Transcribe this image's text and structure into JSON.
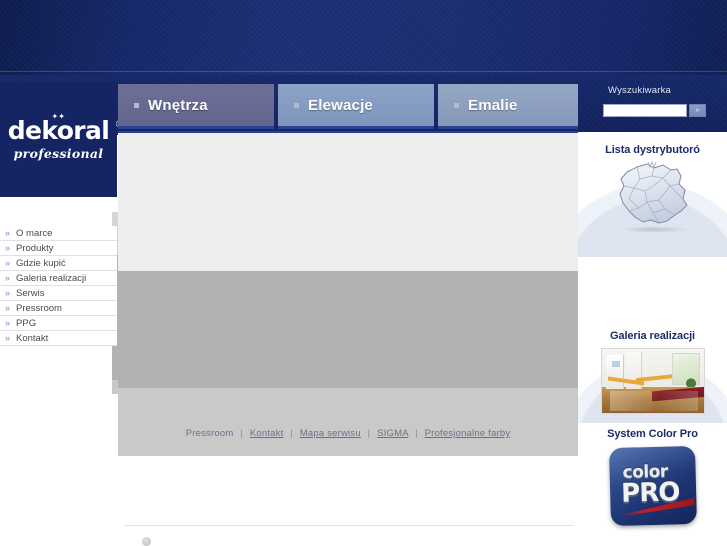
{
  "brand": {
    "logo_main": "dekoral",
    "logo_registered": "®",
    "logo_stars": "✦✦",
    "logo_sub": "professional"
  },
  "tabs": [
    {
      "label": "Wnętrza",
      "state": "active"
    },
    {
      "label": "Elewacje",
      "state": "inactive"
    },
    {
      "label": "Emalie",
      "state": "inactive"
    }
  ],
  "sidebar": {
    "items": [
      {
        "label": "O marce"
      },
      {
        "label": "Produkty"
      },
      {
        "label": "Gdzie kupić"
      },
      {
        "label": "Galeria realizacji"
      },
      {
        "label": "Serwis"
      },
      {
        "label": "Pressroom"
      },
      {
        "label": "PPG"
      },
      {
        "label": "Kontakt"
      }
    ],
    "chevron": "»"
  },
  "search": {
    "label": "Wyszukiwarka",
    "value": "",
    "placeholder": "",
    "button_label": "»"
  },
  "promos": {
    "distributors": {
      "title": "Lista dystrybutoró"
    },
    "gallery": {
      "title": "Galeria realizacji"
    },
    "colorpro": {
      "title": "System Color Pro",
      "logo_top": "color",
      "logo_bottom": "PRO"
    }
  },
  "footer": {
    "links": [
      {
        "label": "Pressroom",
        "underline": false
      },
      {
        "label": "Kontakt",
        "underline": true
      },
      {
        "label": "Mapa serwisu",
        "underline": true
      },
      {
        "label": "SIGMA",
        "underline": true
      },
      {
        "label": "Profesjonalne farby",
        "underline": true
      }
    ],
    "separator": "|"
  },
  "bottom": {
    "left_text": "",
    "right_text": ""
  },
  "colors": {
    "banner_blue": "#16286a",
    "tab_active": "#62658e",
    "tab_inactive": "#7e96bd",
    "accent_underline": "#2b4191",
    "content_bg": "#eeeeee",
    "grey_box": "#b1b2b4",
    "footer_bg": "#c9c9c9",
    "link_color": "#6a7087",
    "promo_title": "#1d2d6b"
  }
}
